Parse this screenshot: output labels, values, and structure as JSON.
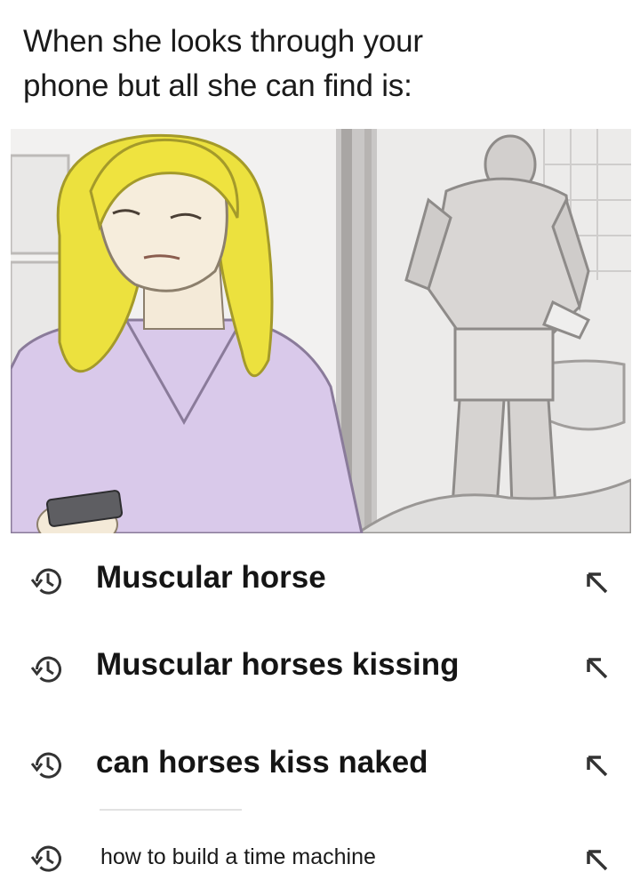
{
  "caption": {
    "line1": "When she looks through your",
    "line2": "phone but all she can find is:"
  },
  "illustration": {
    "kind": "comic-panel",
    "icon": "woman-reading-phone-while-man-stands-in-bathroom"
  },
  "search_history": {
    "row_icon": "history-clock-icon",
    "fill_icon": "arrow-up-left-icon",
    "items": [
      {
        "label": "Muscular horse"
      },
      {
        "label": "Muscular horses kissing"
      },
      {
        "label": "can horses kiss naked"
      },
      {
        "label": "how to build a time machine"
      }
    ]
  },
  "colors": {
    "background": "#ffffff",
    "text": "#151515",
    "hair": "#e9dd3e",
    "shirt": "#d7c8e8"
  }
}
